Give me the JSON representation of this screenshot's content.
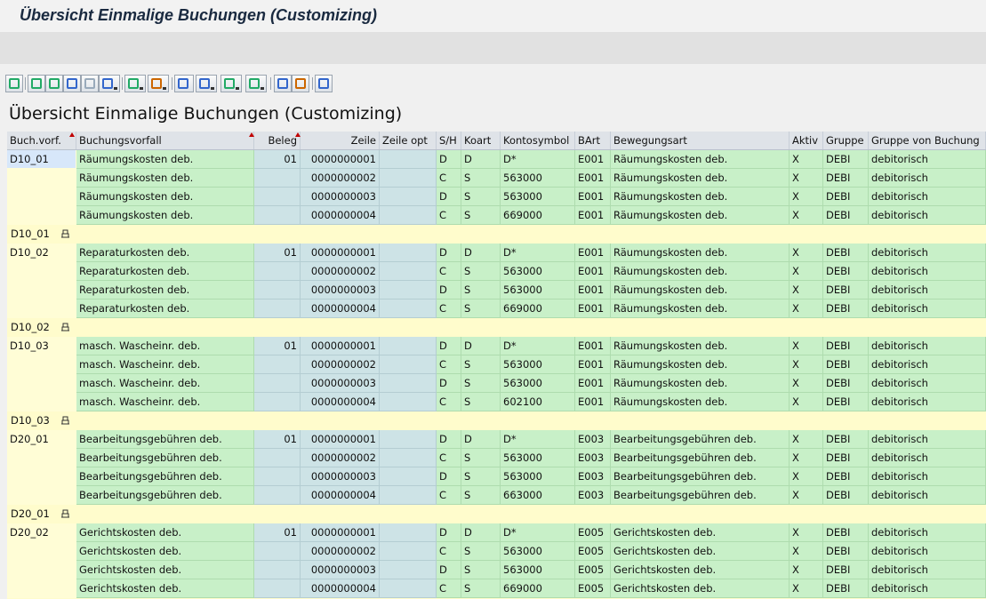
{
  "window_title": "Übersicht Einmalige Buchungen (Customizing)",
  "list_title": "Übersicht Einmalige Buchungen (Customizing)",
  "toolbar": {
    "buttons": [
      "details-icon",
      "sort-ascending-icon",
      "sort-descending-icon",
      "find-icon",
      "find-next-icon",
      "filter-icon",
      "sum-icon",
      "subtotal-icon",
      "print-preview-icon",
      "views-icon",
      "export-icon",
      "layout-icon",
      "abc-analysis-icon",
      "graphic-icon",
      "info-icon"
    ]
  },
  "columns": {
    "vorf": "Buch.vorf.",
    "bvorfall": "Buchungsvorfall",
    "beleg": "Beleg",
    "zeile": "Zeile",
    "zeile_opt": "Zeile opt",
    "sh": "S/H",
    "koart": "Koart",
    "konto": "Kontosymbol",
    "bart": "BArt",
    "bewart": "Bewegungsart",
    "aktiv": "Aktiv",
    "gruppe": "Gruppe",
    "gruppe_von": "Gruppe von Buchung"
  },
  "groups": [
    {
      "key": "D10_01",
      "name": "Räumungskosten  deb.",
      "beleg": "01",
      "bart": "E001",
      "bewart": "Räumungskosten deb.",
      "rows": [
        {
          "zeile": "0000000001",
          "sh": "D",
          "koart": "D",
          "konto": "D*"
        },
        {
          "zeile": "0000000002",
          "sh": "C",
          "koart": "S",
          "konto": "563000"
        },
        {
          "zeile": "0000000003",
          "sh": "D",
          "koart": "S",
          "konto": "563000"
        },
        {
          "zeile": "0000000004",
          "sh": "C",
          "koart": "S",
          "konto": "669000"
        }
      ]
    },
    {
      "key": "D10_02",
      "name": "Reparaturkosten  deb.",
      "beleg": "01",
      "bart": "E001",
      "bewart": "Räumungskosten deb.",
      "rows": [
        {
          "zeile": "0000000001",
          "sh": "D",
          "koart": "D",
          "konto": "D*"
        },
        {
          "zeile": "0000000002",
          "sh": "C",
          "koart": "S",
          "konto": "563000"
        },
        {
          "zeile": "0000000003",
          "sh": "D",
          "koart": "S",
          "konto": "563000"
        },
        {
          "zeile": "0000000004",
          "sh": "C",
          "koart": "S",
          "konto": "669000"
        }
      ]
    },
    {
      "key": "D10_03",
      "name": "masch. Wascheinr. deb.",
      "beleg": "01",
      "bart": "E001",
      "bewart": "Räumungskosten deb.",
      "rows": [
        {
          "zeile": "0000000001",
          "sh": "D",
          "koart": "D",
          "konto": "D*"
        },
        {
          "zeile": "0000000002",
          "sh": "C",
          "koart": "S",
          "konto": "563000"
        },
        {
          "zeile": "0000000003",
          "sh": "D",
          "koart": "S",
          "konto": "563000"
        },
        {
          "zeile": "0000000004",
          "sh": "C",
          "koart": "S",
          "konto": "602100"
        }
      ]
    },
    {
      "key": "D20_01",
      "name": "Bearbeitungsgebühren deb.",
      "beleg": "01",
      "bart": "E003",
      "bewart": "Bearbeitungsgebühren deb.",
      "rows": [
        {
          "zeile": "0000000001",
          "sh": "D",
          "koart": "D",
          "konto": "D*"
        },
        {
          "zeile": "0000000002",
          "sh": "C",
          "koart": "S",
          "konto": "563000"
        },
        {
          "zeile": "0000000003",
          "sh": "D",
          "koart": "S",
          "konto": "563000"
        },
        {
          "zeile": "0000000004",
          "sh": "C",
          "koart": "S",
          "konto": "663000"
        }
      ]
    },
    {
      "key": "D20_02",
      "name": "Gerichtskosten deb.",
      "beleg": "01",
      "bart": "E005",
      "bewart": "Gerichtskosten deb.",
      "rows": [
        {
          "zeile": "0000000001",
          "sh": "D",
          "koart": "D",
          "konto": "D*"
        },
        {
          "zeile": "0000000002",
          "sh": "C",
          "koart": "S",
          "konto": "563000"
        },
        {
          "zeile": "0000000003",
          "sh": "D",
          "koart": "S",
          "konto": "563000"
        },
        {
          "zeile": "0000000004",
          "sh": "C",
          "koart": "S",
          "konto": "669000"
        }
      ]
    }
  ],
  "row_defaults": {
    "aktiv": "X",
    "gruppe": "DEBI",
    "gruppe_von": "debitorisch"
  },
  "colors": {
    "green": "#c8f0c8",
    "blue": "#cde3e6",
    "yellow": "#fffdd6",
    "header": "#dfe3e8"
  }
}
